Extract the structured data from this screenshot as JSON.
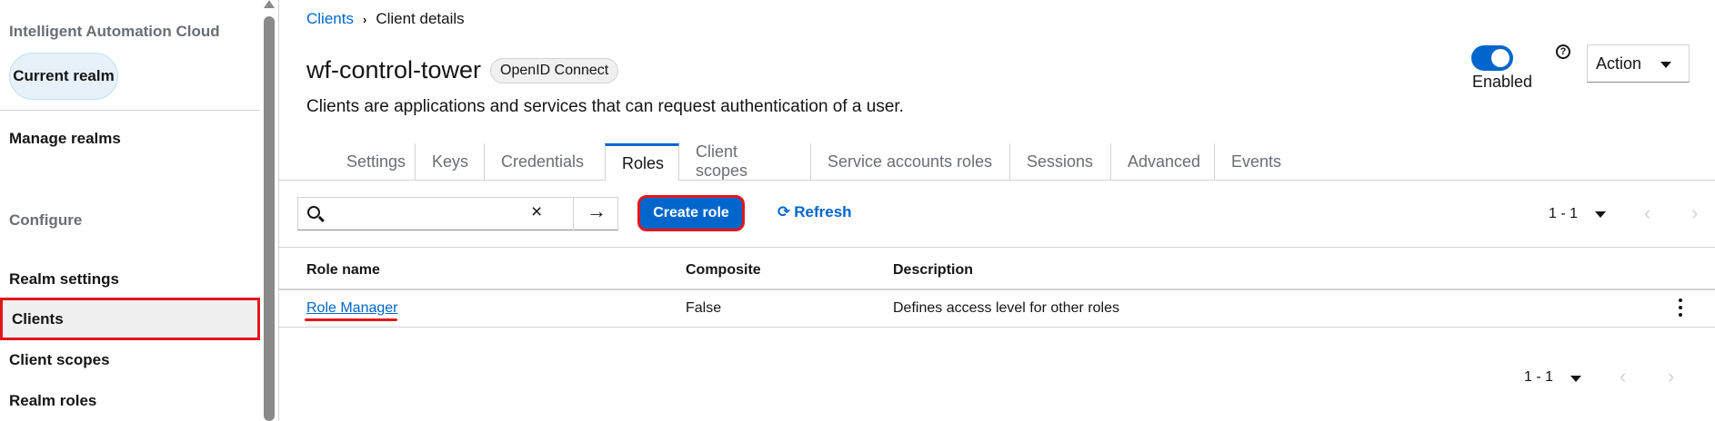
{
  "sidebar": {
    "realm_title": "Intelligent Automation Cloud",
    "current_realm": "Current realm",
    "manage_realms": "Manage realms",
    "configure_title": "Configure",
    "items": [
      {
        "label": "Realm settings",
        "active": false
      },
      {
        "label": "Clients",
        "active": true
      },
      {
        "label": "Client scopes",
        "active": false
      },
      {
        "label": "Realm roles",
        "active": false
      }
    ]
  },
  "breadcrumb": {
    "parent": "Clients",
    "separator": "›",
    "current": "Client details"
  },
  "header": {
    "title": "wf-control-tower",
    "protocol_badge": "OpenID Connect",
    "subtitle": "Clients are applications and services that can request authentication of a user.",
    "enabled_label": "Enabled",
    "enabled": true,
    "help_icon": "?",
    "action_label": "Action"
  },
  "tabs": [
    {
      "label": "Settings",
      "active": false
    },
    {
      "label": "Keys",
      "active": false
    },
    {
      "label": "Credentials",
      "active": false
    },
    {
      "label": "Roles",
      "active": true
    },
    {
      "label": "Client scopes",
      "active": false
    },
    {
      "label": "Service accounts roles",
      "active": false
    },
    {
      "label": "Sessions",
      "active": false
    },
    {
      "label": "Advanced",
      "active": false
    },
    {
      "label": "Events",
      "active": false
    }
  ],
  "toolbar": {
    "search_placeholder": "",
    "clear_icon": "×",
    "go_icon": "→",
    "create_label": "Create role",
    "refresh_label": "Refresh",
    "refresh_icon": "⟳"
  },
  "pagination": {
    "range": "1 - 1",
    "prev_icon": "‹",
    "next_icon": "›"
  },
  "table": {
    "columns": [
      "Role name",
      "Composite",
      "Description"
    ],
    "rows": [
      {
        "name": "Role Manager",
        "composite": "False",
        "description": "Defines access level for other roles"
      }
    ]
  },
  "colors": {
    "accent": "#0066cc",
    "highlight": "#e4161c",
    "muted": "#6a6e73"
  }
}
